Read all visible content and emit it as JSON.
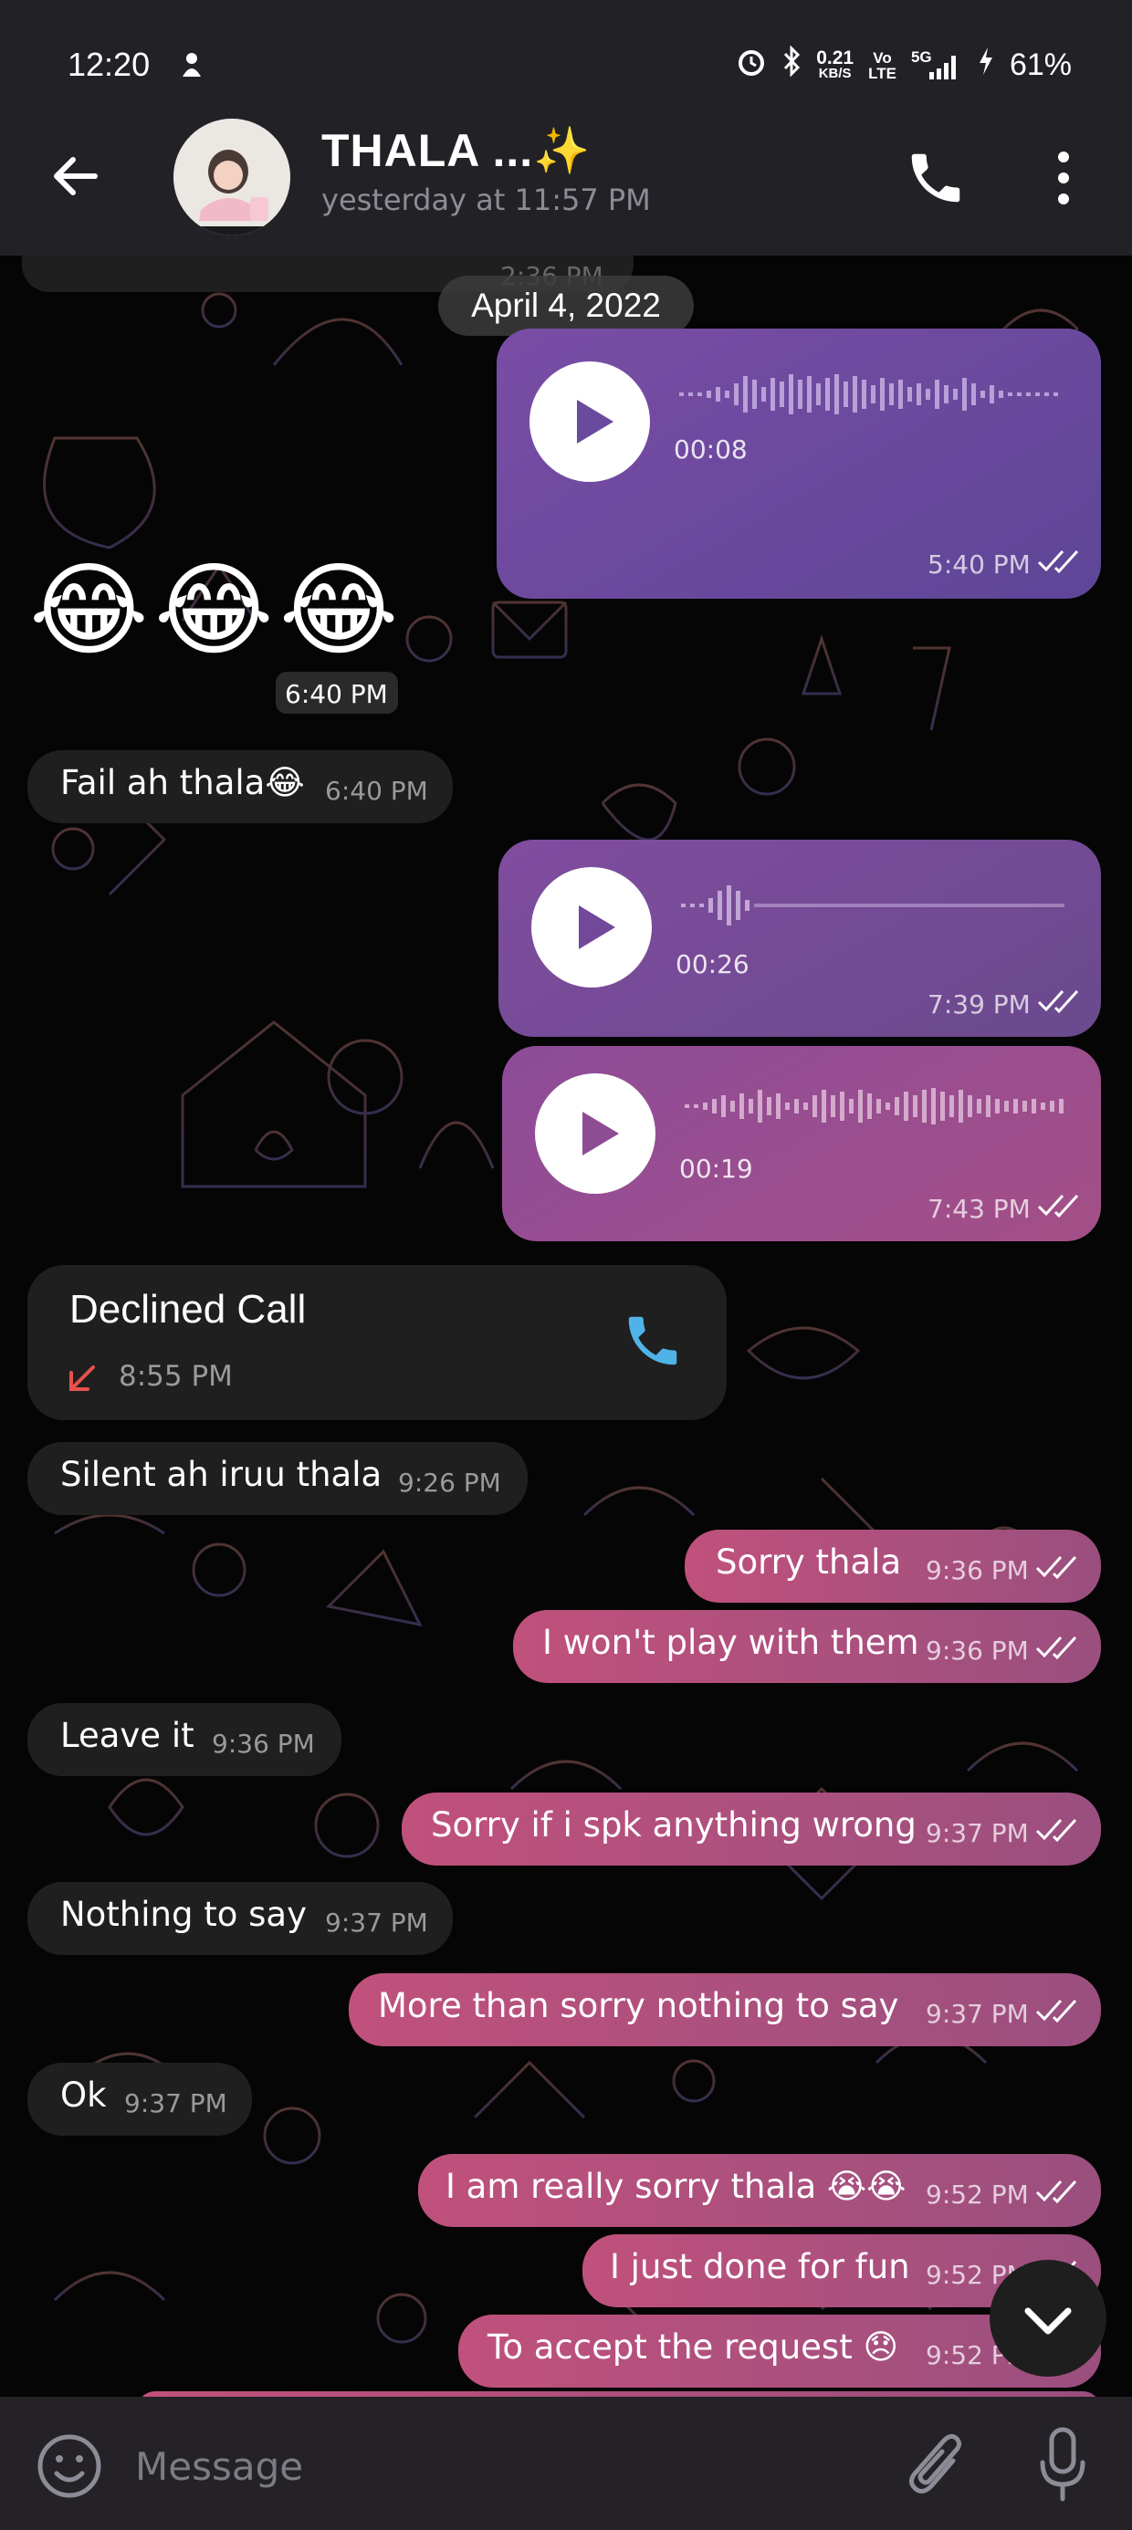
{
  "status_bar": {
    "time": "12:20",
    "speed_value": "0.21",
    "speed_unit": "KB/S",
    "volte_top": "Vo",
    "volte_bottom": "LTE",
    "network": "5G",
    "battery": "61%",
    "icons": [
      "notification-icon",
      "alarm-icon",
      "bluetooth-icon",
      "signal-icon",
      "charging-icon"
    ]
  },
  "header": {
    "contact_name": "THALA ...✨",
    "last_seen": "yesterday at 11:57 PM",
    "icons": [
      "back-arrow-icon",
      "phone-icon",
      "more-vert-icon"
    ]
  },
  "chat": {
    "partial_top_time": "2:36 PM",
    "date_divider": "April 4, 2022",
    "messages": [
      {
        "type": "voice",
        "dir": "out",
        "duration": "00:08",
        "time": "5:40 PM",
        "status": "read"
      },
      {
        "type": "emoji",
        "dir": "in",
        "text": "😂😂😂",
        "time": "6:40 PM"
      },
      {
        "type": "text",
        "dir": "in",
        "text": "Fail ah thala😂",
        "time": "6:40 PM"
      },
      {
        "type": "voice",
        "dir": "out",
        "duration": "00:26",
        "time": "7:39 PM",
        "status": "read"
      },
      {
        "type": "voice",
        "dir": "out",
        "duration": "00:19",
        "time": "7:43 PM",
        "status": "read"
      },
      {
        "type": "call",
        "dir": "in",
        "title": "Declined Call",
        "time": "8:55 PM"
      },
      {
        "type": "text",
        "dir": "in",
        "text": "Silent ah iruu thala",
        "time": "9:26 PM"
      },
      {
        "type": "text",
        "dir": "out",
        "text": "Sorry thala",
        "time": "9:36 PM",
        "status": "read"
      },
      {
        "type": "text",
        "dir": "out",
        "text": "I won't play with them",
        "time": "9:36 PM",
        "status": "read"
      },
      {
        "type": "text",
        "dir": "in",
        "text": "Leave it",
        "time": "9:36 PM"
      },
      {
        "type": "text",
        "dir": "out",
        "text": "Sorry if i spk anything wrong",
        "time": "9:37 PM",
        "status": "read"
      },
      {
        "type": "text",
        "dir": "in",
        "text": "Nothing to say",
        "time": "9:37 PM"
      },
      {
        "type": "text",
        "dir": "out",
        "text": "More than sorry nothing to say",
        "time": "9:37 PM",
        "status": "read"
      },
      {
        "type": "text",
        "dir": "in",
        "text": "Ok",
        "time": "9:37 PM"
      },
      {
        "type": "text",
        "dir": "out",
        "text": "I am really sorry thala 😭😭",
        "time": "9:52 PM",
        "status": "read"
      },
      {
        "type": "text",
        "dir": "out",
        "text": "I just done for fun",
        "time": "9:52 PM",
        "status": "read"
      },
      {
        "type": "text",
        "dir": "out",
        "text": "To accept the request 😞",
        "time": "9:52 PM",
        "status": "read"
      }
    ]
  },
  "input": {
    "placeholder": "Message",
    "icons": [
      "emoji-icon",
      "attach-icon",
      "mic-icon"
    ]
  },
  "colors": {
    "outgoing_start": "#c0517c",
    "outgoing_end": "#9a4f7f",
    "voice_top": "#6c4aa5",
    "incoming": "#1f1f1f",
    "call_icon": "#4fb3e8",
    "declined_arrow": "#e5534b"
  }
}
